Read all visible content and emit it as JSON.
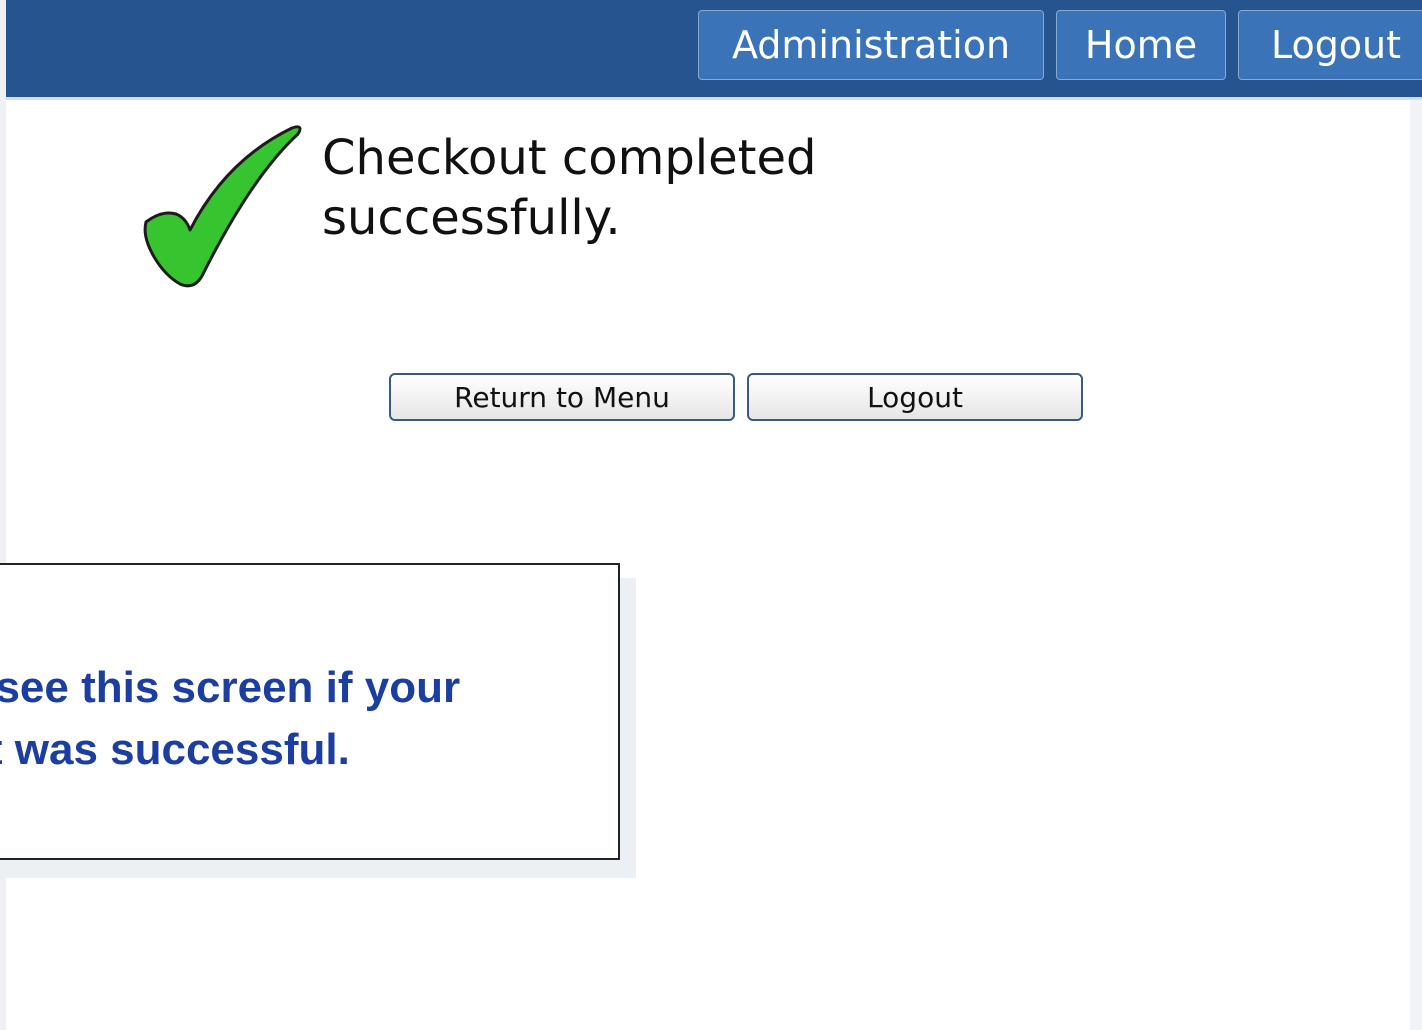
{
  "header": {
    "nav": {
      "administration": "Administration",
      "home": "Home",
      "logout": "Logout"
    }
  },
  "main": {
    "icon": "checkmark-icon",
    "message": "Checkout completed successfully.",
    "buttons": {
      "return": "Return to Menu",
      "logout": "Logout"
    }
  },
  "callout": {
    "line1": "l see this screen if your",
    "line2": "pt was successful."
  },
  "colors": {
    "header_bg": "#26548e",
    "nav_button": "#3b73b9",
    "check_green": "#37c52f",
    "callout_text": "#1b3ea0"
  }
}
